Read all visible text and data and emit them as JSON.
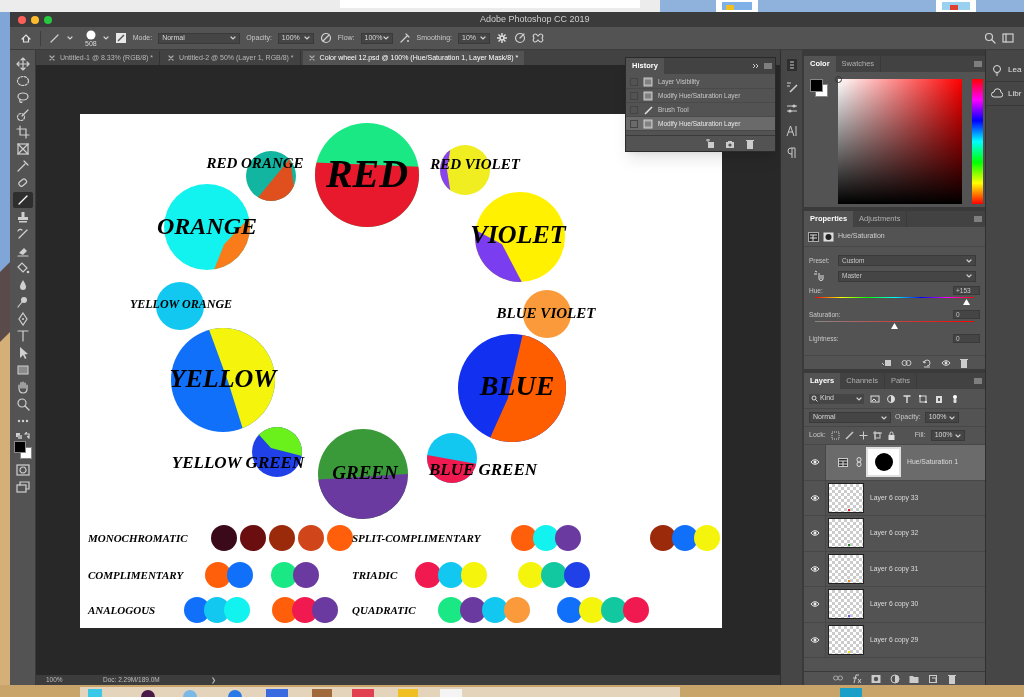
{
  "window": {
    "title": "Adobe Photoshop CC 2019"
  },
  "options_bar": {
    "brush_size": "508",
    "mode_label": "Mode:",
    "mode": "Normal",
    "opacity_label": "Opacity:",
    "opacity": "100%",
    "flow_label": "Flow:",
    "flow": "100%",
    "smoothing_label": "Smoothing:",
    "smoothing": "10%"
  },
  "tabs": [
    {
      "label": "Untitled-1 @ 8.33% (RGB/8) *",
      "selected": false
    },
    {
      "label": "Untitled-2 @ 50% (Layer 1, RGB/8) *",
      "selected": false
    },
    {
      "label": "Color wheel 12.psd @ 100% (Hue/Saturation 1, Layer Mask/8) *",
      "selected": true
    }
  ],
  "canvas": {
    "wheel": [
      {
        "label": "RED ORANGE",
        "segments": [
          {
            "color": "#12b5a0"
          },
          {
            "color": "#e0501e"
          }
        ]
      },
      {
        "label": "RED",
        "segments": [
          {
            "color": "#19e884"
          },
          {
            "color": "#e8192c"
          }
        ]
      },
      {
        "label": "RED VIOLET",
        "segments": [
          {
            "color": "#f0ee20"
          },
          {
            "color": "#8844ee"
          }
        ]
      },
      {
        "label": "ORANGE",
        "segments": [
          {
            "color": "#12f2ee"
          },
          {
            "color": "#fa7b1a"
          }
        ]
      },
      {
        "label": "VIOLET",
        "segments": [
          {
            "color": "#fff100"
          },
          {
            "color": "#7a3ef0"
          }
        ]
      },
      {
        "label": "YELLOW ORANGE",
        "segments": [
          {
            "color": "#12c8f0"
          }
        ]
      },
      {
        "label": "BLUE VIOLET",
        "segments": [
          {
            "color": "#fa9a3a"
          }
        ]
      },
      {
        "label": "YELLOW",
        "segments": [
          {
            "color": "#1070fa"
          },
          {
            "color": "#f4f40c"
          }
        ]
      },
      {
        "label": "BLUE",
        "segments": [
          {
            "color": "#1230f0"
          },
          {
            "color": "#ff5e00"
          }
        ]
      },
      {
        "label": "YELLOW GREEN",
        "segments": [
          {
            "color": "#2040e8"
          },
          {
            "color": "#6af01a"
          }
        ]
      },
      {
        "label": "GREEN",
        "segments": [
          {
            "color": "#3a9a3a"
          },
          {
            "color": "#6a3aa0"
          }
        ]
      },
      {
        "label": "BLUE GREEN",
        "segments": [
          {
            "color": "#12c8f0"
          },
          {
            "color": "#f01a50"
          }
        ]
      }
    ],
    "schemes": [
      {
        "label": "MONOCHROMATIC",
        "groups": [
          {
            "swatches": [
              {
                "color": "#3a0a1a"
              },
              {
                "color": "#6a0e10"
              },
              {
                "color": "#9a2a0a"
              },
              {
                "color": "#d0461a"
              },
              {
                "color": "#ff5e0a"
              }
            ]
          }
        ]
      },
      {
        "label": "SPLIT-COMPLIMENTARY",
        "groups": [
          {
            "swatches": [
              {
                "color": "#ff5e0a"
              },
              {
                "color": "#12f2ee"
              },
              {
                "color": "#6a3aa0"
              }
            ]
          },
          {
            "swatches": [
              {
                "color": "#9a2a0a"
              },
              {
                "color": "#1070fa"
              },
              {
                "color": "#f4f40c"
              }
            ]
          }
        ]
      },
      {
        "label": "COMPLIMENTARY",
        "groups": [
          {
            "swatches": [
              {
                "color": "#ff5e0a"
              },
              {
                "color": "#1070fa"
              }
            ]
          },
          {
            "swatches": [
              {
                "color": "#19e884"
              },
              {
                "color": "#6a3aa0"
              }
            ]
          }
        ]
      },
      {
        "label": "TRIADIC",
        "groups": [
          {
            "swatches": [
              {
                "color": "#f01a50"
              },
              {
                "color": "#12c8f0"
              },
              {
                "color": "#f4f40c"
              }
            ]
          },
          {
            "swatches": [
              {
                "color": "#f4f40c"
              },
              {
                "color": "#12c8a0"
              },
              {
                "color": "#2040e8"
              }
            ]
          }
        ]
      },
      {
        "label": "ANALOGOUS",
        "groups": [
          {
            "swatches": [
              {
                "color": "#1070fa"
              },
              {
                "color": "#12c8f0"
              },
              {
                "color": "#12f2ee"
              }
            ]
          },
          {
            "swatches": [
              {
                "color": "#ff5e0a"
              },
              {
                "color": "#f01a50"
              },
              {
                "color": "#6a3aa0"
              }
            ]
          }
        ]
      },
      {
        "label": "QUADRATIC",
        "groups": [
          {
            "swatches": [
              {
                "color": "#19e884"
              },
              {
                "color": "#6a3aa0"
              },
              {
                "color": "#12c8f0"
              },
              {
                "color": "#fa9a3a"
              }
            ]
          },
          {
            "swatches": [
              {
                "color": "#1070fa"
              },
              {
                "color": "#f4f40c"
              },
              {
                "color": "#12c8a0"
              },
              {
                "color": "#f01a50"
              }
            ]
          }
        ]
      }
    ]
  },
  "history": {
    "title": "History",
    "items": [
      {
        "label": "Layer Visibility",
        "kind": "document",
        "selected": false
      },
      {
        "label": "Modify Hue/Saturation Layer",
        "kind": "document",
        "selected": false
      },
      {
        "label": "Brush Tool",
        "kind": "brush",
        "selected": false
      },
      {
        "label": "Modify Hue/Saturation Layer",
        "kind": "document",
        "selected": true
      }
    ]
  },
  "color_panel": {
    "tabs": [
      {
        "label": "Color",
        "selected": true
      },
      {
        "label": "Swatches",
        "selected": false
      }
    ]
  },
  "properties": {
    "tabs": [
      {
        "label": "Properties",
        "selected": true
      },
      {
        "label": "Adjustments",
        "selected": false
      }
    ],
    "title": "Hue/Saturation",
    "preset_label": "Preset:",
    "preset": "Custom",
    "channel": "Master",
    "sliders": [
      {
        "label": "Hue:",
        "value": "+153",
        "kind": "hue",
        "level": 0.95
      },
      {
        "label": "Saturation:",
        "value": "0",
        "kind": "saturation",
        "level": 0.5
      },
      {
        "label": "Lightness:",
        "value": "0"
      }
    ]
  },
  "layers": {
    "tabs": [
      {
        "label": "Layers",
        "selected": true
      },
      {
        "label": "Channels",
        "selected": false
      },
      {
        "label": "Paths",
        "selected": false
      }
    ],
    "filter": "Kind",
    "blend": "Normal",
    "opacity_label": "Opacity:",
    "opacity": "100%",
    "lock_label": "Lock:",
    "fill_label": "Fill:",
    "fill": "100%",
    "items": [
      {
        "name": "Hue/Saturation 1",
        "kind": "adjustment",
        "selected": true
      },
      {
        "name": "Layer 6 copy 33",
        "kind": "pixel",
        "selected": false,
        "color": "#e82020"
      },
      {
        "name": "Layer 6 copy 32",
        "kind": "pixel",
        "selected": false,
        "color": "#2a8a2a"
      },
      {
        "name": "Layer 6 copy 31",
        "kind": "pixel",
        "selected": false,
        "color": "#f08a1a"
      },
      {
        "name": "Layer 6 copy 30",
        "kind": "pixel",
        "selected": false,
        "color": "#6a5af0"
      },
      {
        "name": "Layer 6 copy 29",
        "kind": "pixel",
        "selected": false,
        "color": "#f0e010"
      }
    ]
  },
  "right_dock": [
    {
      "label": "Lea"
    },
    {
      "label": "Libr"
    }
  ],
  "status_bar": {
    "zoom": "100%",
    "doc": "Doc: 2.29M/189.0M",
    "arrow": "❯"
  }
}
